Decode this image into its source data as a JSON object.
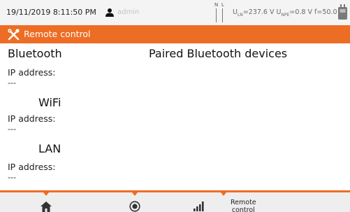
{
  "status_bar": {
    "datetime": "19/11/2019 8:11:50 PM",
    "user": "admin",
    "nl_indicator": {
      "n": "N",
      "l": "L"
    },
    "readings": {
      "uln_label": "U",
      "uln_sub": "LN",
      "uln_value": "=237.6 V",
      "upe_label": "U",
      "upe_sub": "NPE",
      "upe_value": "=0.8 V",
      "freq": "f=50.0 Hz"
    },
    "icons": {
      "user": "user-icon",
      "device": "device-icon",
      "nl": "nl-indicator-icon"
    }
  },
  "title_bar": {
    "title": "Remote control",
    "icon": "tools-icon",
    "color": "#ee6d24"
  },
  "main": {
    "bluetooth": {
      "heading": "Bluetooth",
      "ip_label": "IP address:",
      "ip_value": "---"
    },
    "paired_heading": "Paired Bluetooth devices",
    "wifi": {
      "heading": "WiFi",
      "ip_label": "IP address:",
      "ip_value": "---"
    },
    "lan": {
      "heading": "LAN",
      "ip_label": "IP address:",
      "ip_value": "---"
    }
  },
  "bottom_bar": {
    "remote_label_line1": "Remote",
    "remote_label_line2": "control",
    "icons": [
      "home-icon",
      "record-icon",
      "signal-icon"
    ]
  },
  "colors": {
    "accent": "#ee6d24",
    "status_bg": "#f4f4f4",
    "bottom_bg": "#eeeeee"
  }
}
